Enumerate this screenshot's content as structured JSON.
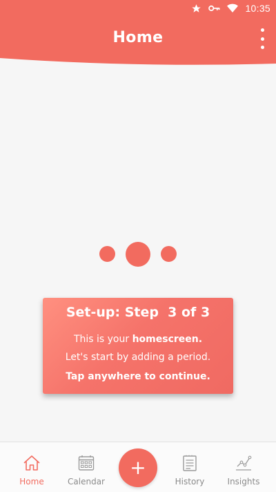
{
  "status_bar": {
    "time": "10:35",
    "icons": [
      "star-icon",
      "key-icon",
      "wifi-icon"
    ]
  },
  "header": {
    "title": "Home",
    "menu_icon": "more-vert-icon"
  },
  "loader": {
    "dots": 3
  },
  "setup_card": {
    "title": "Set-up: Step  3 of 3",
    "line1_prefix": "This is your ",
    "line1_bold": "homescreen.",
    "line2": "Let's start by adding a period.",
    "line3": "Tap anywhere to continue."
  },
  "bottom_nav": {
    "items": [
      {
        "label": "Home",
        "icon": "home-icon",
        "active": true
      },
      {
        "label": "Calendar",
        "icon": "calendar-icon",
        "active": false
      },
      {
        "label": "History",
        "icon": "history-icon",
        "active": false
      },
      {
        "label": "Insights",
        "icon": "insights-icon",
        "active": false
      }
    ],
    "fab_symbol": "+"
  },
  "colors": {
    "accent": "#f26b5f",
    "background": "#f6f6f6",
    "nav_inactive": "#8a8a8a"
  }
}
